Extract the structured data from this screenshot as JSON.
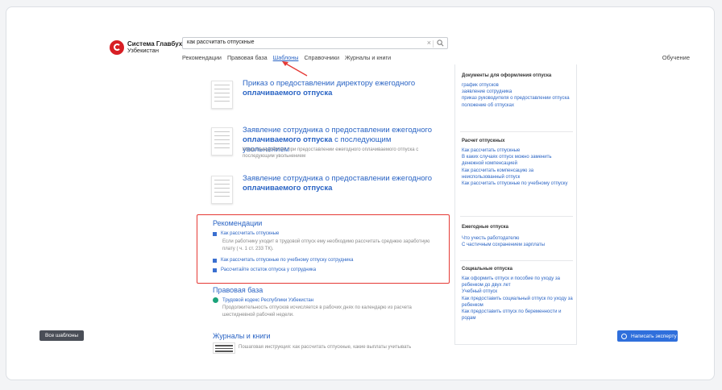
{
  "app": {
    "logo_line1": "Система Главбух",
    "logo_line2": "Узбекистан"
  },
  "search": {
    "value": "как рассчитать отпускные",
    "clear": "×"
  },
  "tabs": [
    "Рекомендации",
    "Правовая база",
    "Шаблоны",
    "Справочники",
    "Журналы и книги"
  ],
  "header": {
    "training": "Обучение"
  },
  "documents": [
    {
      "title_pre": "Приказ о предоставлении директору ежегодного ",
      "title_bold": "оплачиваемого отпуска",
      "title_post": "",
      "desc": ""
    },
    {
      "title_pre": "Заявление сотрудника о предоставлении ежегодного ",
      "title_bold": "оплачиваемого отпуска",
      "title_post": " с последующим увольнением",
      "desc": "Когда понадобится: при предоставлении ежегодного оплачиваемого отпуска с последующим увольнением"
    },
    {
      "title_pre": "Заявление сотрудника о предоставлении ежегодного ",
      "title_bold": "оплачиваемого отпуска",
      "title_post": "",
      "desc": ""
    }
  ],
  "recommendations": {
    "title": "Рекомендации",
    "items": [
      {
        "text": "Как рассчитать отпускные",
        "desc": "Если работнику уходит в трудовой отпуск ему необходимо рассчитать среднюю заработную плату ( ч. 1 ст. 233 ТК)."
      },
      {
        "text": "Как рассчитать отпускные по учебному отпуску сотрудника",
        "desc": ""
      },
      {
        "text": "Рассчитайте остаток отпуска у сотрудника",
        "desc": ""
      }
    ]
  },
  "law": {
    "title": "Правовая база",
    "item": "Трудовой кодекс Республики Узбекистан",
    "desc": "Продолжительность отпусков исчисляется в рабочих днях по календарю из расчета шестидневной рабочей недели."
  },
  "journals": {
    "title": "Журналы и книги",
    "item": "Пошаговая инструкция: как рассчитать отпускные, какие выплаты учитывать"
  },
  "sidebar": {
    "groups": [
      {
        "title": "Документы для оформления отпуска",
        "links": [
          "график отпусков",
          "заявление сотрудника",
          "приказ руководителя о предоставлении отпуска",
          "положение об отпусках"
        ]
      },
      {
        "title": "Расчет отпускных",
        "links": [
          "Как рассчитать отпускные",
          "В каких случаях отпуск можно заменить денежной компенсацией",
          "Как рассчитать компенсацию за неиспользованный отпуск",
          "Как рассчитать отпускные по учебному отпуску"
        ]
      },
      {
        "title": "Ежегодные отпуска",
        "links": [
          "Что учесть работодателю",
          "С частичным сохранением зарплаты"
        ]
      },
      {
        "title": "Социальные отпуска",
        "links": [
          "Как оформить отпуск и пособие по уходу за ребенком до двух лет",
          "Учебный отпуск",
          "Как предоставить социальный отпуск по уходу за ребенком",
          "Как предоставить отпуск по беременности и родам"
        ]
      }
    ]
  },
  "buttons": {
    "all_templates": "Все шаблоны",
    "ask_expert": "Написать эксперту"
  },
  "colors": {
    "accent": "#2a64c4",
    "highlight": "#e53935",
    "brand": "#d81e24"
  }
}
